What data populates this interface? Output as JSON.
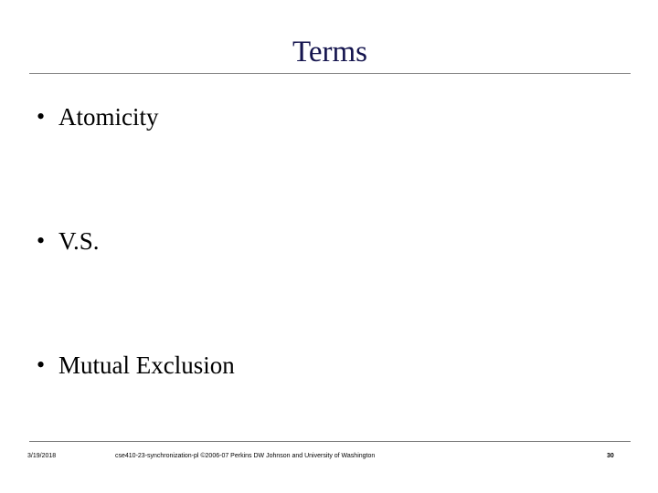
{
  "slide": {
    "title": "Terms",
    "title_color": "#14144e",
    "background_color": "#ffffff",
    "body_color": "#000000",
    "rule_color": "#8a8a8a",
    "bullets": [
      {
        "marker": "•",
        "label": "Atomicity"
      },
      {
        "marker": "•",
        "label": "V.S."
      },
      {
        "marker": "•",
        "label": "Mutual Exclusion"
      }
    ],
    "footer": {
      "date": "3/19/2018",
      "credit": "cse410-23-synchronization-pl ©2006-07 Perkins DW Johnson and University of Washington",
      "page_number": "30"
    }
  }
}
